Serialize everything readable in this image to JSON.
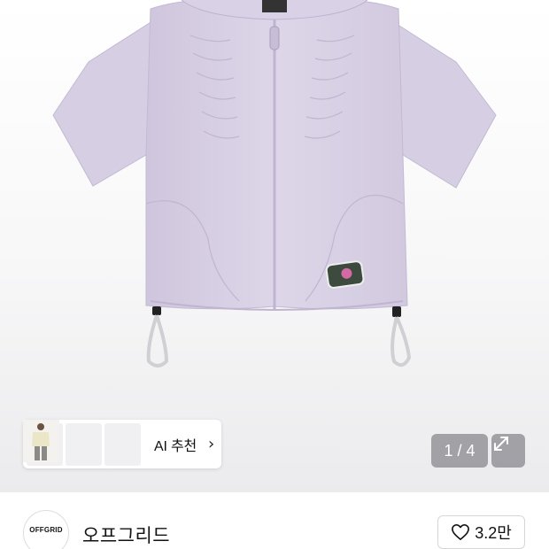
{
  "product_image": {
    "alt": "lavender shirred zip-up short sleeve jacket",
    "garment_color": "#d8d0e4",
    "background_color": "#f4f4f6"
  },
  "ai_recommend": {
    "label": "AI 추천",
    "chevron_icon": "chevron-right-icon"
  },
  "pager": {
    "current": 1,
    "total": 4,
    "text": "1 / 4",
    "expand_icon": "expand-arrows-icon"
  },
  "brand": {
    "logo_text": "OFFGRID",
    "name": "오프그리드"
  },
  "like": {
    "icon": "heart-icon",
    "count": "3.2만"
  }
}
